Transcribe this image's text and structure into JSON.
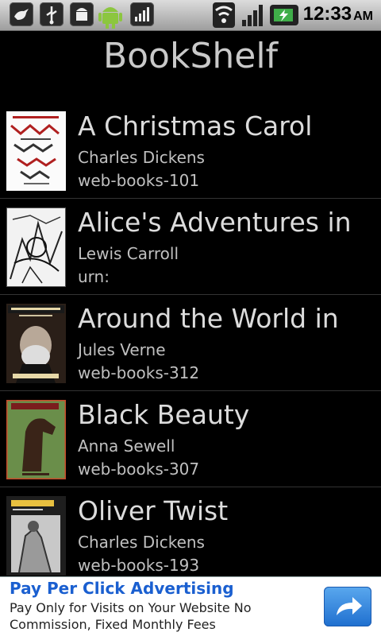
{
  "status_bar": {
    "icons": [
      "twitter-bird-icon",
      "usb-icon",
      "android-debug-icon",
      "android-robot-icon",
      "signal-bars-icon",
      "wifi-icon",
      "cell-signal-icon",
      "battery-charging-icon"
    ],
    "time": "12:33",
    "ampm": "AM"
  },
  "app": {
    "title": "BookShelf"
  },
  "books": [
    {
      "title": "A Christmas Carol",
      "author": "Charles Dickens",
      "id": "web-books-101"
    },
    {
      "title": "Alice's Adventures in",
      "author": "Lewis Carroll",
      "id": "urn:"
    },
    {
      "title": "Around the World in",
      "author": "Jules Verne",
      "id": "web-books-312"
    },
    {
      "title": "Black Beauty",
      "author": "Anna Sewell",
      "id": "web-books-307"
    },
    {
      "title": "Oliver Twist",
      "author": "Charles Dickens",
      "id": "web-books-193"
    }
  ],
  "ad": {
    "title": "Pay Per Click Advertising",
    "text": "Pay Only for Visits on Your Website No Commission, Fixed Monthly Fees"
  }
}
